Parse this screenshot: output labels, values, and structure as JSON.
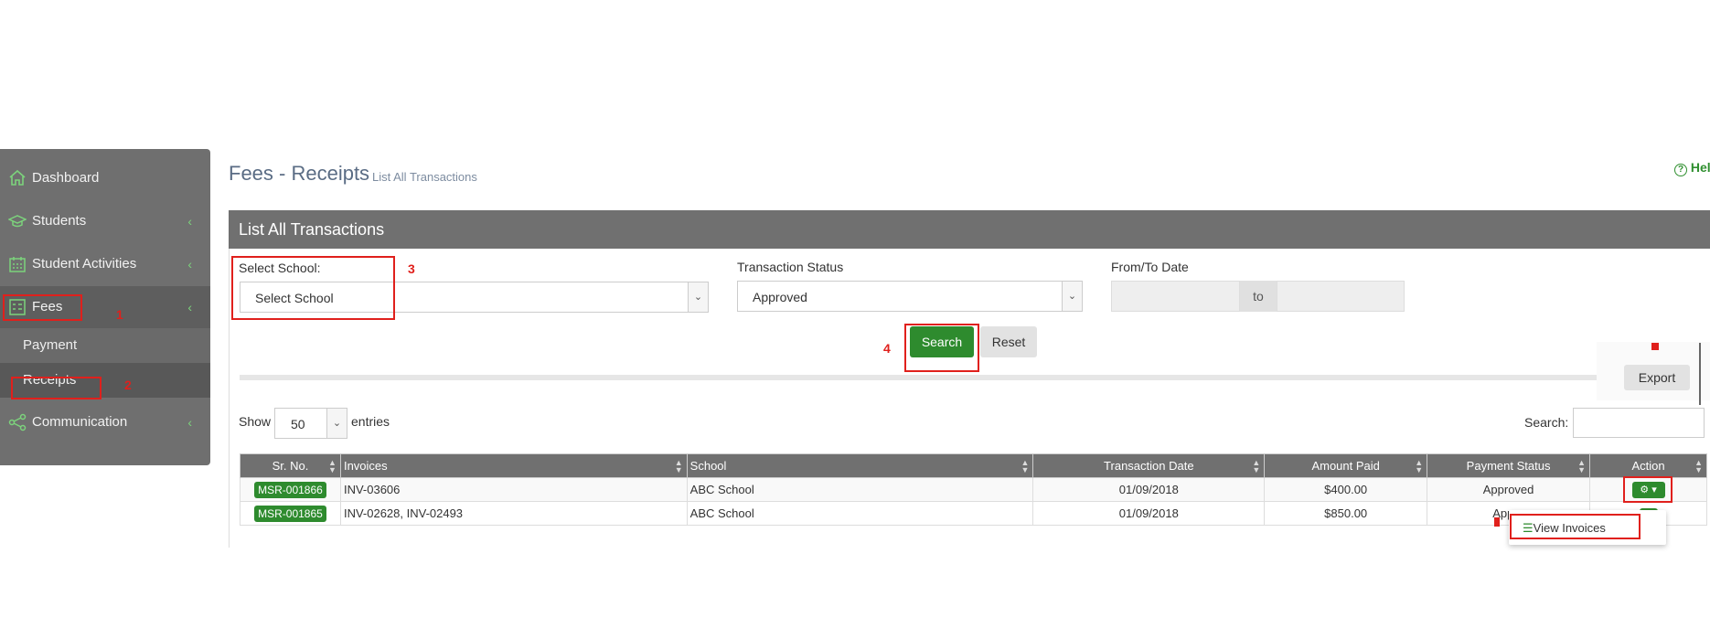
{
  "sidebar": {
    "items": [
      {
        "label": "Dashboard",
        "icon": "home-icon"
      },
      {
        "label": "Students",
        "icon": "graduation-cap-icon"
      },
      {
        "label": "Student Activities",
        "icon": "calendar-icon"
      },
      {
        "label": "Fees",
        "icon": "fees-list-icon"
      },
      {
        "label": "Communication",
        "icon": "share-icon"
      }
    ],
    "sub_items": [
      {
        "label": "Payment"
      },
      {
        "label": "Receipts"
      }
    ],
    "chevron": "‹"
  },
  "header": {
    "title": "Fees - Receipts",
    "subtitle": "List All Transactions",
    "help": "Help"
  },
  "panel": {
    "title": "List All Transactions",
    "filters": {
      "school_label": "Select School:",
      "school_value": "Select School",
      "status_label": "Transaction Status",
      "status_value": "Approved",
      "date_label": "From/To Date",
      "date_to": "to"
    },
    "search_label": "Search",
    "reset_label": "Reset",
    "export_label": "Export",
    "show_label": "Show",
    "entries_value": "50",
    "entries_label": "entries",
    "table_search_label": "Search:"
  },
  "table": {
    "columns": [
      "Sr. No.",
      "Invoices",
      "School",
      "Transaction Date",
      "Amount Paid",
      "Payment Status",
      "Action"
    ],
    "rows": [
      {
        "sr": "MSR-001866",
        "invoices": "INV-03606",
        "school": "ABC School",
        "date": "01/09/2018",
        "amount": "$400.00",
        "status": "Approved"
      },
      {
        "sr": "MSR-001865",
        "invoices": "INV-02628, INV-02493",
        "school": "ABC School",
        "date": "01/09/2018",
        "amount": "$850.00",
        "status": "Appro"
      }
    ]
  },
  "dropdown": {
    "view_invoices": "View Invoices"
  },
  "annotations": {
    "n1": "1",
    "n2": "2",
    "n3": "3",
    "n4": "4"
  },
  "colors": {
    "accent_green": "#2e8b2e",
    "sidebar_bg": "#6f6f6f",
    "header_bg": "#707070",
    "annotation_red": "#e0201c"
  }
}
